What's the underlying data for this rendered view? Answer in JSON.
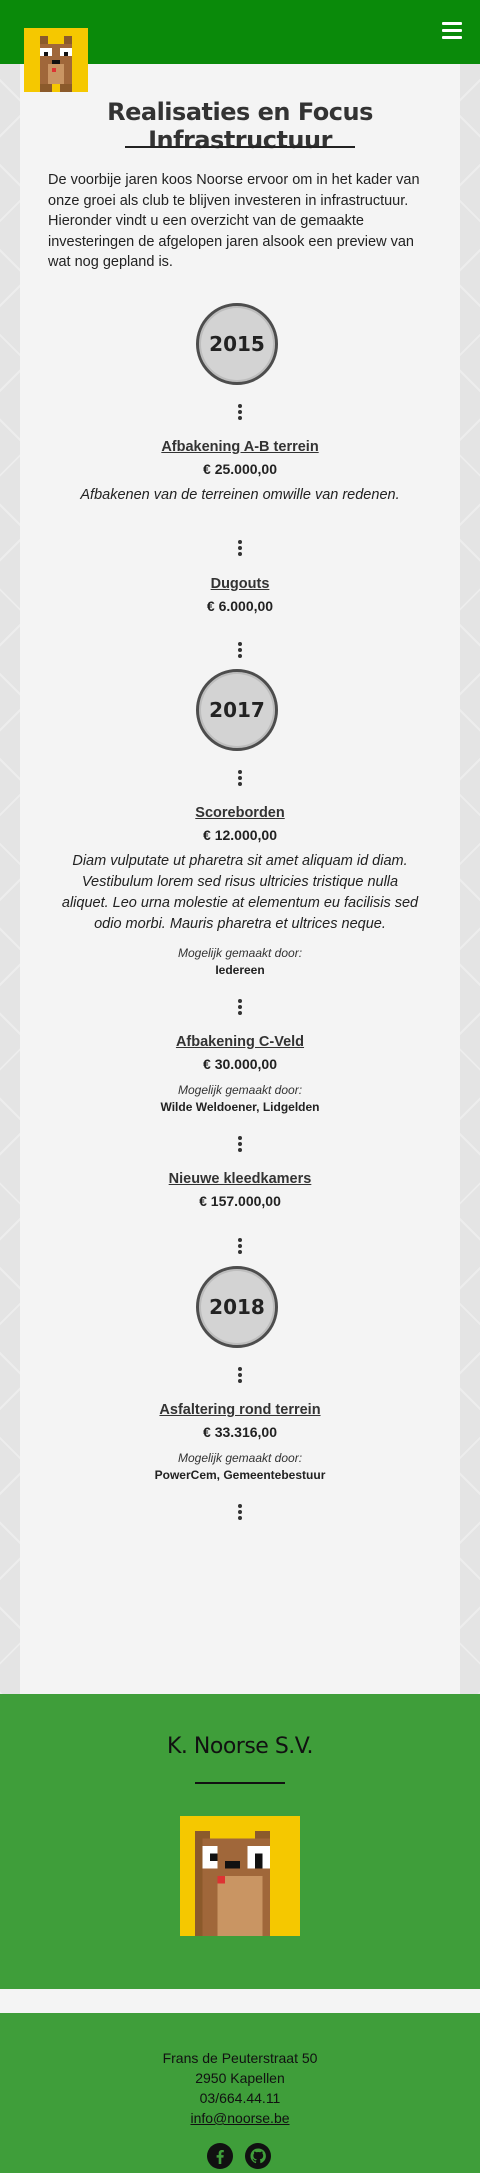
{
  "colors": {
    "header": "#0a8a0a",
    "footer": "#3f9e3a",
    "card": "#f4f4f4"
  },
  "header": {
    "menu_icon": "hamburger-icon",
    "logo_icon": "mascot-logo"
  },
  "page": {
    "title": "Realisaties en Focus Infrastructuur",
    "intro": "De voorbije jaren koos Noorse ervoor om in het kader van onze groei als club te blijven investeren in infrastructuur. Hieronder vindt u een overzicht van de gemaakte investeringen de afgelopen jaren alsook een preview van wat nog gepland is."
  },
  "timeline": {
    "made_by_label": "Mogelijk gemaakt door:",
    "years": [
      "2015",
      "2017",
      "2018"
    ],
    "items": [
      {
        "title": "Afbakening A-B terrein",
        "price": "€ 25.000,00",
        "desc": "Afbakenen van de terreinen omwille van redenen."
      },
      {
        "title": "Dugouts",
        "price": "€ 6.000,00"
      },
      {
        "title": "Scoreborden",
        "price": "€ 12.000,00",
        "desc": "Diam vulputate ut pharetra sit amet aliquam id diam. Vestibulum lorem sed risus ultricies tristique nulla aliquet. Leo urna molestie at elementum eu facilisis sed odio morbi. Mauris pharetra et ultrices neque.",
        "made_by": "Iedereen"
      },
      {
        "title": "Afbakening C-Veld",
        "price": "€ 30.000,00",
        "made_by": "Wilde Weldoener, Lidgelden"
      },
      {
        "title": "Nieuwe kleedkamers",
        "price": "€ 157.000,00"
      },
      {
        "title": "Asfaltering rond terrein",
        "price": "€ 33.316,00",
        "made_by": "PowerCem, Gemeentebestuur"
      }
    ]
  },
  "footer": {
    "club_name": "K. Noorse S.V.",
    "address": "Frans de Peuterstraat 50",
    "city": "2950 Kapellen",
    "phone": "03/664.44.11",
    "email": "info@noorse.be",
    "social_icons": [
      "facebook-icon",
      "github-icon"
    ]
  }
}
